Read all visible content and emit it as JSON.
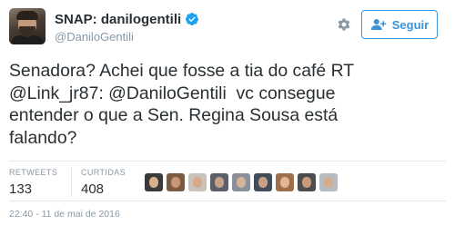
{
  "user": {
    "display_name": "SNAP: danilogentili",
    "handle": "@DaniloGentili",
    "verified": true,
    "avatar_icon": "user-avatar"
  },
  "actions": {
    "settings_icon": "gear-icon",
    "follow_label": "Seguir",
    "follow_icon": "add-user-icon"
  },
  "tweet": {
    "lines": [
      "Senadora? Achei que fosse a tia do café RT",
      "@Link_jr87: @DaniloGentili  vc consegue",
      "entender o que a Sen. Regina Sousa está",
      "falando?"
    ]
  },
  "stats": {
    "retweets_label": "RETWEETS",
    "retweets_value": "133",
    "likes_label": "CURTIDAS",
    "likes_value": "408"
  },
  "likers": [
    {
      "bg": "#3a3a3a",
      "skin": "#d9b08c"
    },
    {
      "bg": "#7a5a40",
      "skin": "#c89674"
    },
    {
      "bg": "#c9c4bb",
      "skin": "#d8a988"
    },
    {
      "bg": "#5a5f6a",
      "skin": "#c7a288"
    },
    {
      "bg": "#8a8f99",
      "skin": "#d3b39a"
    },
    {
      "bg": "#3f4d5c",
      "skin": "#caa084"
    },
    {
      "bg": "#9e6f49",
      "skin": "#e0b894"
    },
    {
      "bg": "#4d4d4d",
      "skin": "#c79b7b"
    },
    {
      "bg": "#b7bcc2",
      "skin": "#d6ad8c"
    }
  ],
  "timestamp": "22:40 - 11 de mai de 2016",
  "colors": {
    "accent": "#3b94d9",
    "muted": "#8899a6",
    "text": "#292f33",
    "verified": "#1da1f2"
  }
}
